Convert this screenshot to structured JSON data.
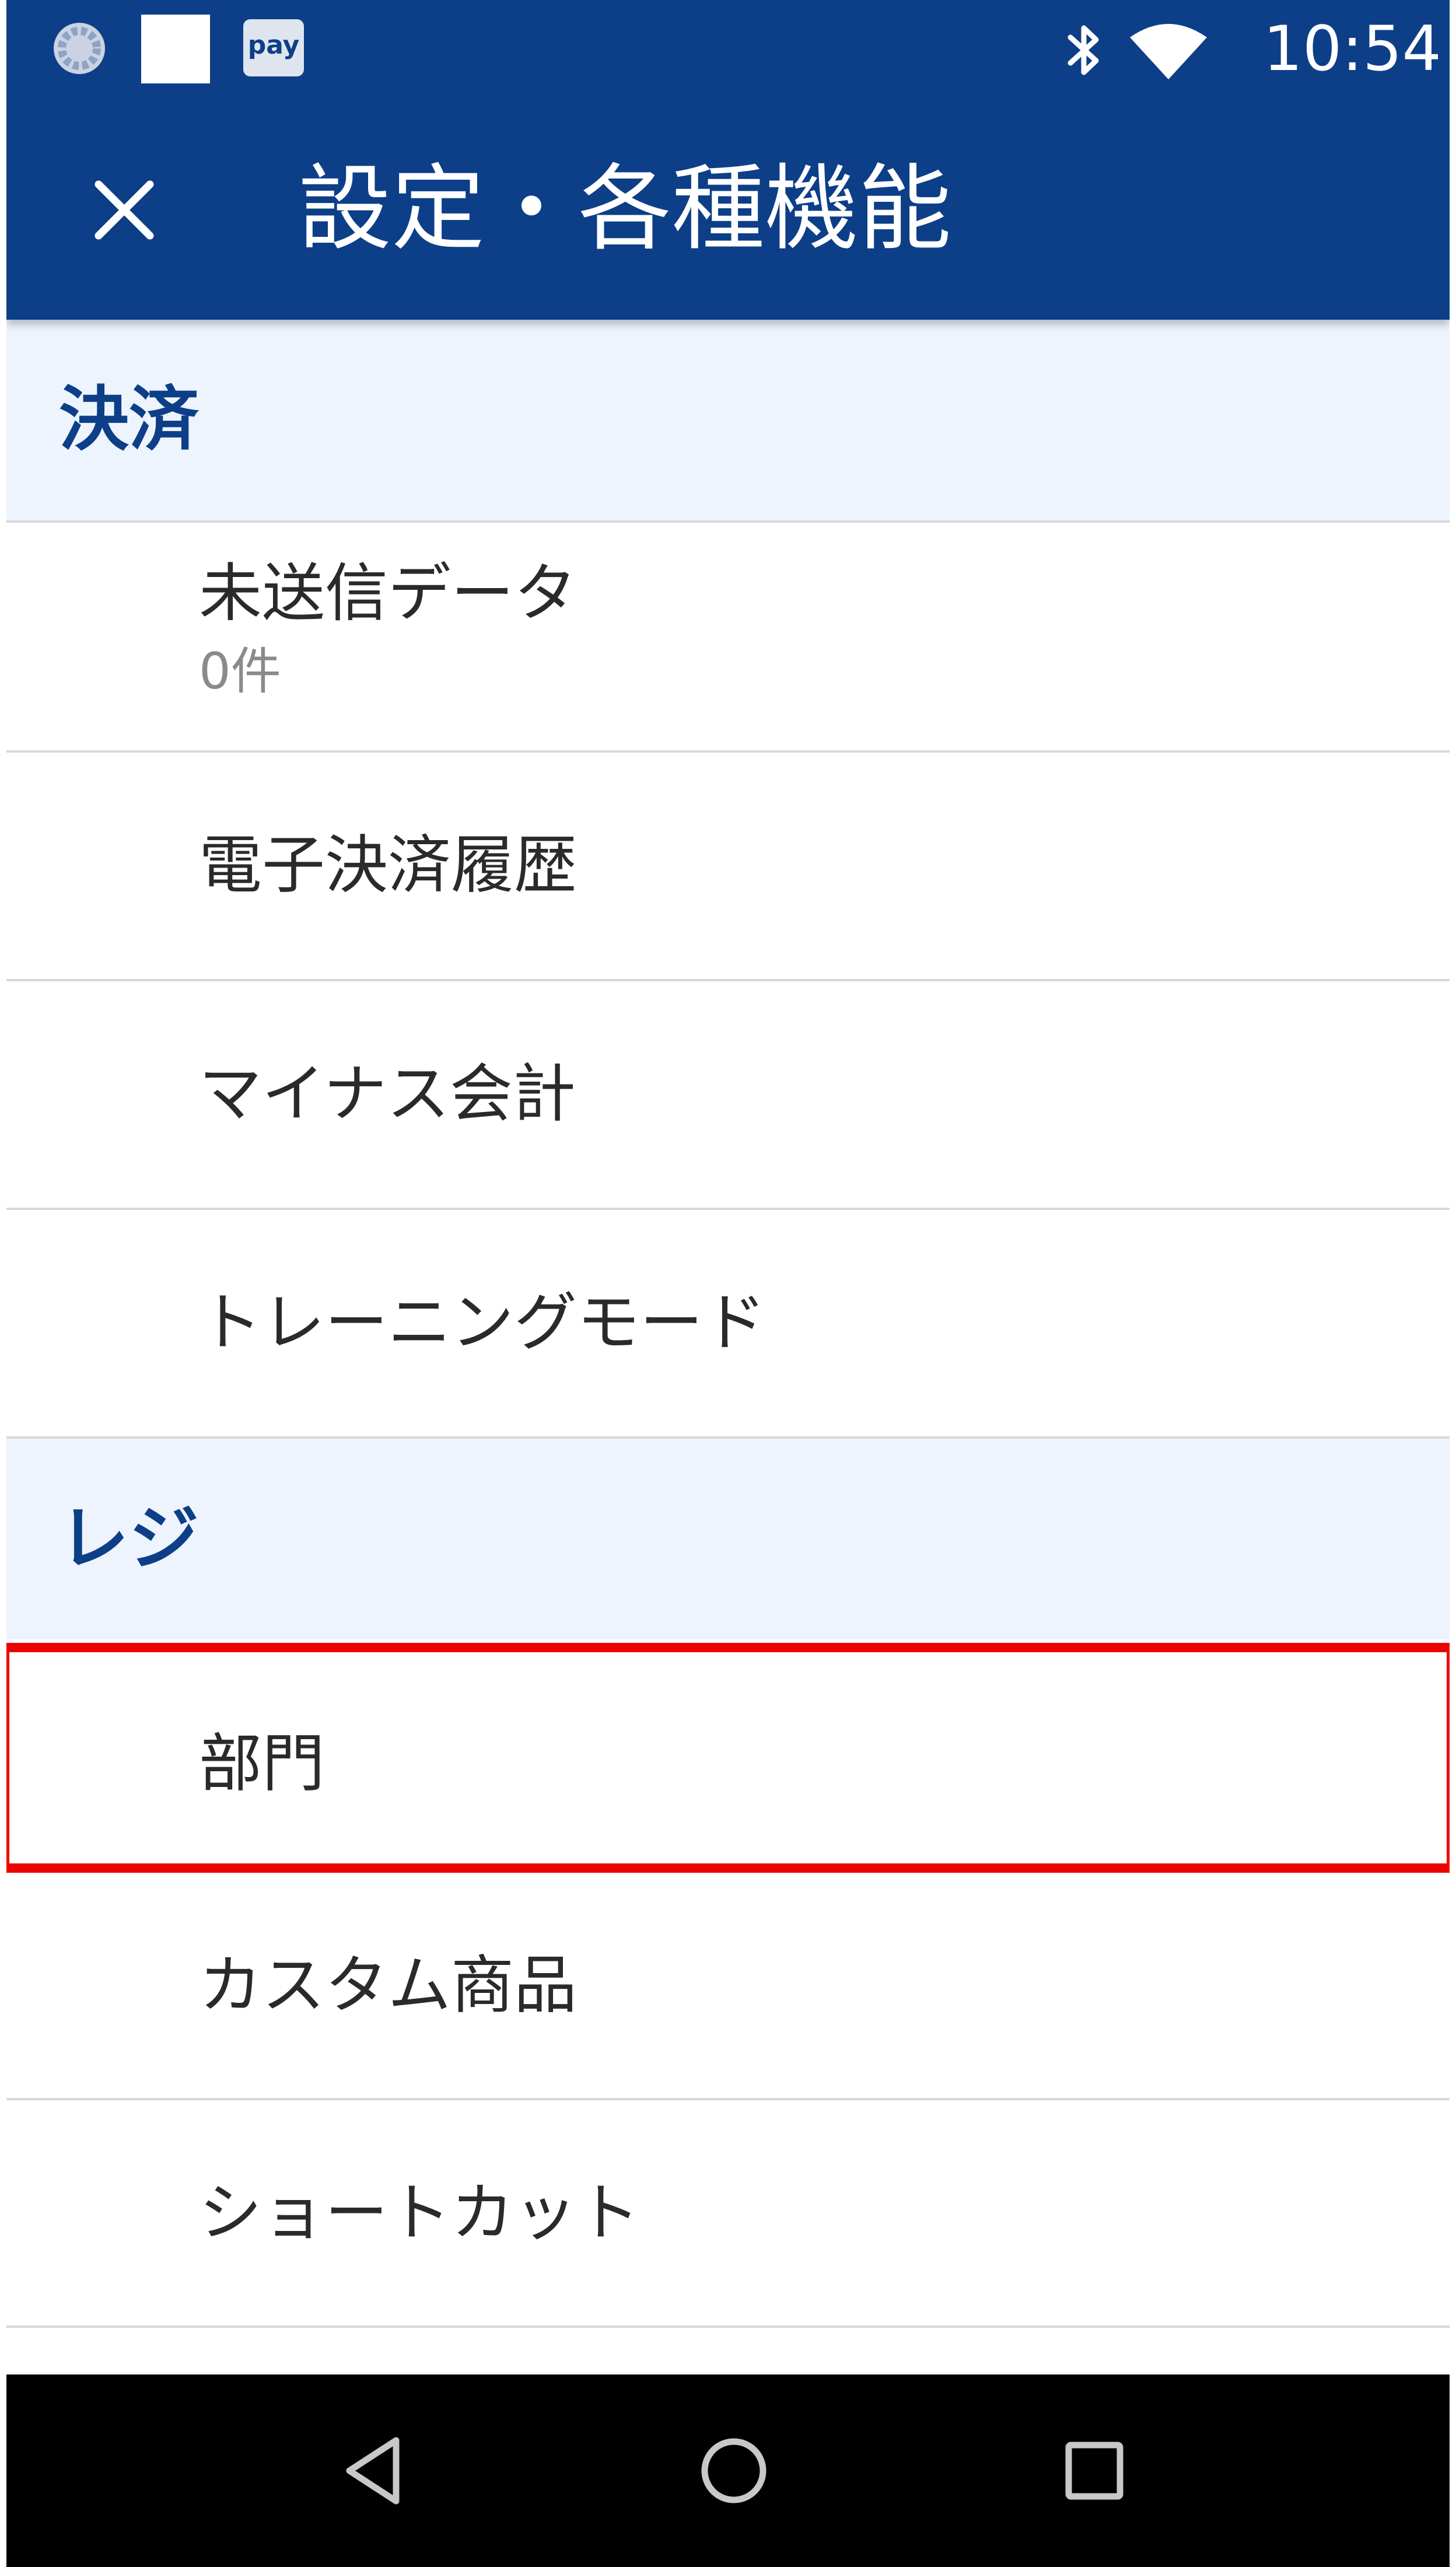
{
  "status_bar": {
    "time": "10:54",
    "left_icons": [
      "sync-icon",
      "square-icon",
      "pay-icon"
    ],
    "pay_label": "pay",
    "right_icons": [
      "bluetooth-icon",
      "wifi-icon"
    ]
  },
  "app_bar": {
    "close_icon": "close-icon",
    "title": "設定・各種機能"
  },
  "sections": [
    {
      "header": "決済",
      "items": [
        {
          "label": "未送信データ",
          "subtitle": "0件"
        },
        {
          "label": "電子決済履歴"
        },
        {
          "label": "マイナス会計"
        },
        {
          "label": "トレーニングモード"
        }
      ]
    },
    {
      "header": "レジ",
      "items": [
        {
          "label": "部門",
          "highlighted": true
        },
        {
          "label": "カスタム商品"
        },
        {
          "label": "ショートカット"
        }
      ]
    }
  ],
  "nav_bar": {
    "icons": [
      "back-icon",
      "home-icon",
      "recents-icon"
    ]
  },
  "colors": {
    "primary": "#0d3f88",
    "section_bg": "#eef4fd",
    "highlight": "#ee0000",
    "text": "#2a2a2a",
    "subtext": "#8a8a8a"
  }
}
